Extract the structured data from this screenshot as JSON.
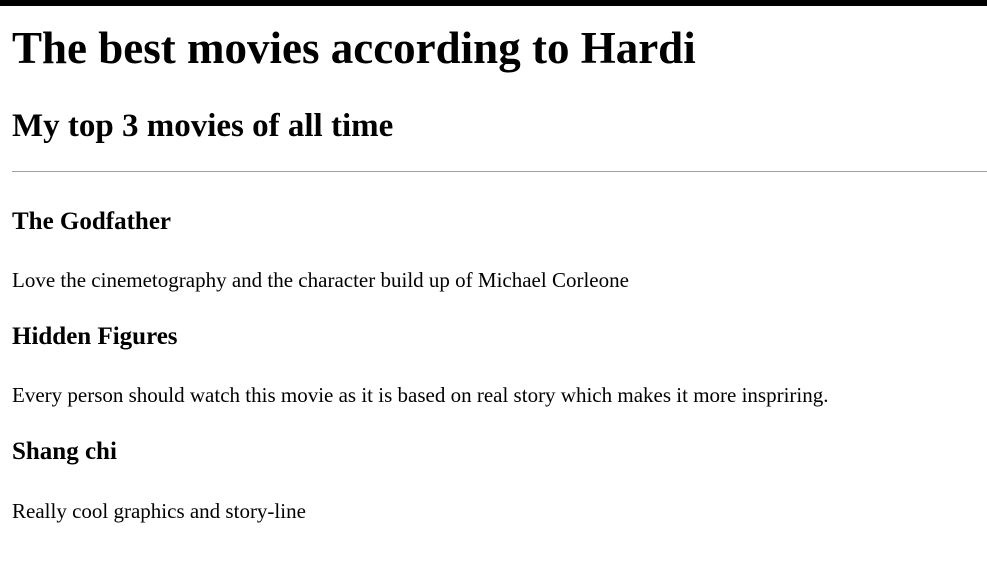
{
  "page": {
    "title": "The best movies according to Hardi",
    "subtitle": "My top 3 movies of all time"
  },
  "movies": [
    {
      "title": "The Godfather",
      "description": "Love the cinemetography and the character build up of Michael Corleone"
    },
    {
      "title": "Hidden Figures",
      "description": "Every person should watch this movie as it is based on real story which makes it more inspriring."
    },
    {
      "title": "Shang chi",
      "description": "Really cool graphics and story-line"
    }
  ],
  "colors": {
    "top_bar": "#000000",
    "divider": "#a0a0a0",
    "background": "#ffffff",
    "text": "#000000"
  }
}
